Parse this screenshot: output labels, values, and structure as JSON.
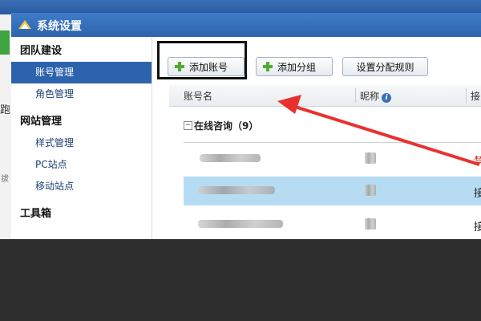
{
  "window": {
    "title": "系统设置"
  },
  "background": {
    "left_char": "跑",
    "left_char2": "拔"
  },
  "sidebar": {
    "groups": [
      {
        "label": "团队建设",
        "items": [
          {
            "label": "账号管理",
            "active": true
          },
          {
            "label": "角色管理"
          }
        ]
      },
      {
        "label": "网站管理",
        "items": [
          {
            "label": "样式管理"
          },
          {
            "label": "PC站点"
          },
          {
            "label": "移动站点"
          }
        ]
      },
      {
        "label": "工具箱",
        "items": []
      }
    ]
  },
  "toolbar": {
    "add_account_label": "添加账号",
    "add_group_label": "添加分组",
    "assign_rules_label": "设置分配规则"
  },
  "table": {
    "columns": [
      "账号名",
      "昵称",
      "接"
    ],
    "group_label": "在线咨询（9）",
    "collapse_glyph": "−",
    "rows": [
      {
        "status": "禁",
        "selected": false
      },
      {
        "status": "接",
        "selected": true
      },
      {
        "status": "接",
        "selected": false
      }
    ]
  },
  "colors": {
    "accent": "#2d63ad",
    "selected_row": "#b6dcf4",
    "annotation": "#e8312f",
    "status_disabled": "#cc2a1e"
  },
  "icons": {
    "logo": "app-logo-icon",
    "plus": "plus-icon",
    "info": "info-icon"
  }
}
